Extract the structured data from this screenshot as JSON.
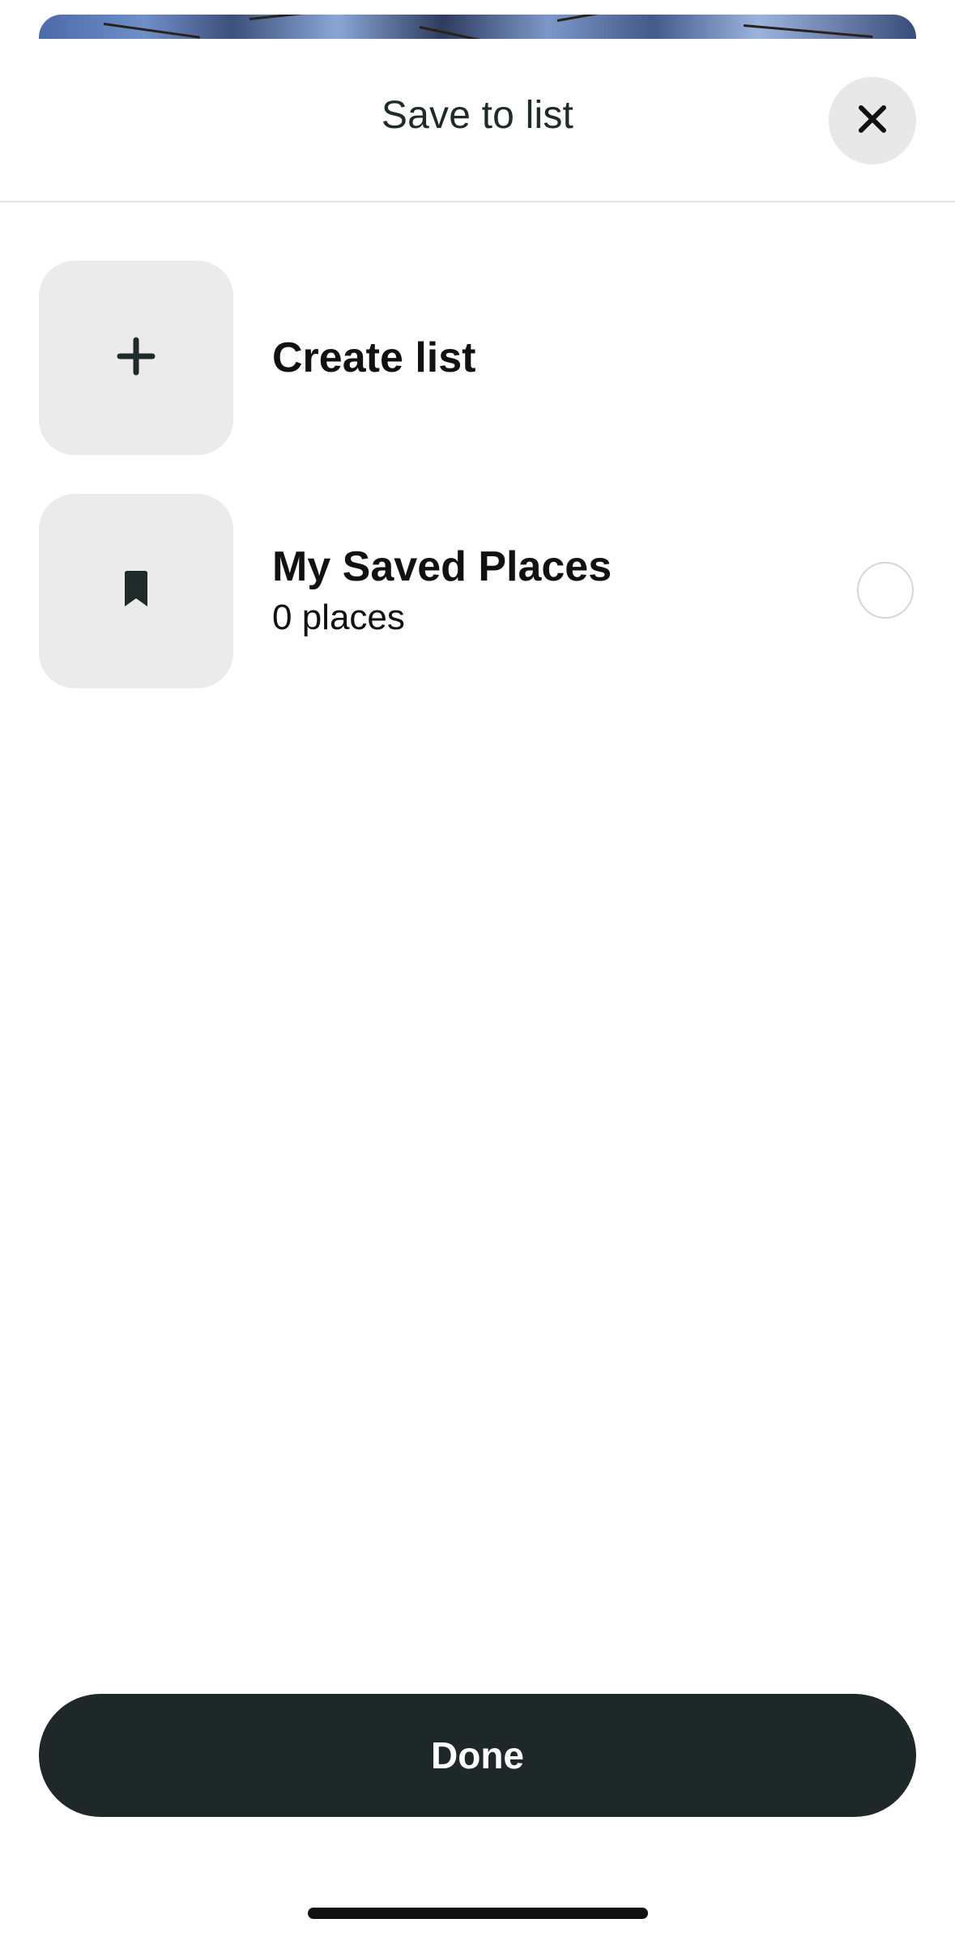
{
  "header": {
    "title": "Save to list",
    "close_icon": "close-icon"
  },
  "lists": [
    {
      "icon": "plus-icon",
      "title": "Create list"
    },
    {
      "icon": "bookmark-icon",
      "title": "My Saved Places",
      "subtitle": "0 places",
      "selected": false
    }
  ],
  "footer": {
    "done_label": "Done"
  },
  "colors": {
    "primary_dark": "#1f2828",
    "tile_bg": "#ebebeb",
    "divider": "#e3e3e3"
  }
}
